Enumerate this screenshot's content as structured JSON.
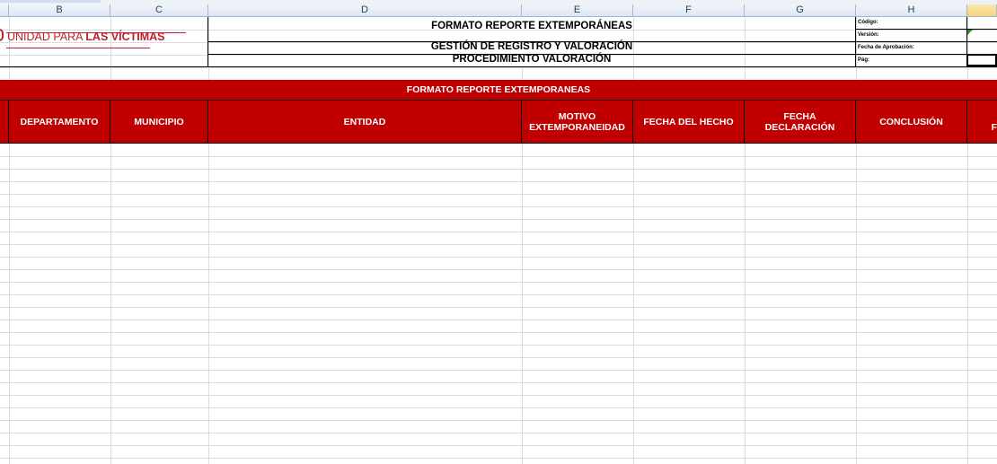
{
  "sheet": {
    "columns": [
      "B",
      "C",
      "D",
      "E",
      "F",
      "G",
      "H"
    ],
    "selected_column": "",
    "header": {
      "title": "FORMATO REPORTE EXTEMPORÁNEAS",
      "subtitle": "GESTIÓN DE REGISTRO Y VALORACIÓN",
      "procedure": "PROCEDIMIENTO VALORACIÓN",
      "labels": {
        "code": "Código:",
        "version": "Versión:",
        "approval_date": "Fecha de Aprobación:",
        "page": "Pág:"
      }
    },
    "logo": {
      "text_regular": "UNIDAD PARA ",
      "text_bold": "LAS VÍCTIMAS",
      "brand_color": "#c0202a"
    },
    "banner": "FORMATO REPORTE EXTEMPORANEAS",
    "table_headers": [
      "DEPARTAMENTO",
      "MUNICIPIO",
      "ENTIDAD",
      "MOTIVO EXTEMPORANEIDAD",
      "FECHA DEL HECHO",
      "FECHA DECLARACIÓN",
      "CONCLUSIÓN",
      "F"
    ],
    "accent_color": "#c00000"
  }
}
